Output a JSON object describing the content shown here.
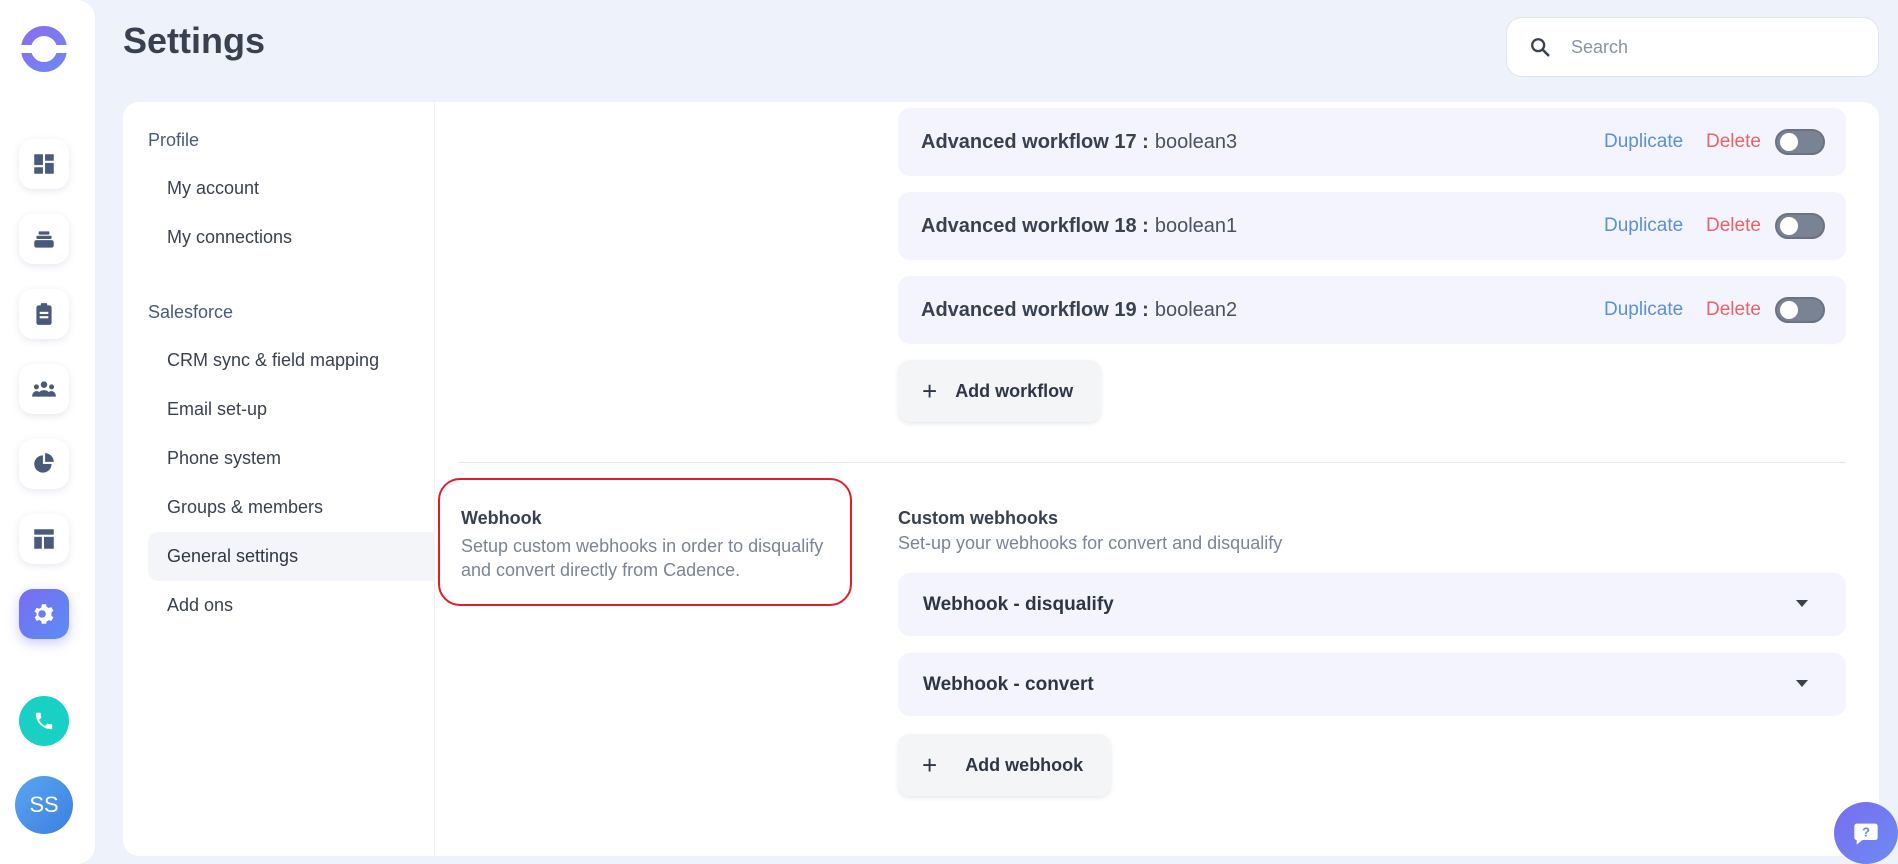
{
  "header": {
    "title": "Settings",
    "search_placeholder": "Search"
  },
  "rail": {
    "icons": [
      "dashboard-icon",
      "tasks-stack-icon",
      "clipboard-icon",
      "people-icon",
      "pie-chart-icon",
      "templates-icon",
      "settings-gear-icon"
    ],
    "active": "settings-gear-icon",
    "avatar_initials": "SS"
  },
  "sidenav": {
    "sections": [
      {
        "label": "Profile",
        "items": [
          "My account",
          "My connections"
        ]
      },
      {
        "label": "Salesforce",
        "items": [
          "CRM sync & field mapping",
          "Email set-up",
          "Phone system",
          "Groups & members",
          "General settings",
          "Add ons"
        ]
      }
    ],
    "active_item": "General settings"
  },
  "workflows": [
    {
      "title": "Advanced workflow 17 :",
      "value": "boolean3",
      "duplicate": "Duplicate",
      "delete": "Delete",
      "enabled": false
    },
    {
      "title": "Advanced workflow 18 :",
      "value": "boolean1",
      "duplicate": "Duplicate",
      "delete": "Delete",
      "enabled": false
    },
    {
      "title": "Advanced workflow 19 :",
      "value": "boolean2",
      "duplicate": "Duplicate",
      "delete": "Delete",
      "enabled": false
    }
  ],
  "add_workflow_label": "Add workflow",
  "webhook_section": {
    "title": "Webhook",
    "description": "Setup custom webhooks in order to disqualify and convert directly from Cadence.",
    "custom_title": "Custom webhooks",
    "custom_description": "Set-up your webhooks for convert and disqualify",
    "dropdowns": [
      "Webhook - disqualify",
      "Webhook - convert"
    ],
    "add_webhook_label": "Add webhook"
  },
  "colors": {
    "accent": "#7a6cf0",
    "duplicate": "#5b8fd8",
    "delete": "#e56464",
    "highlight_border": "#e01e2a",
    "phone": "#18d1c4"
  }
}
